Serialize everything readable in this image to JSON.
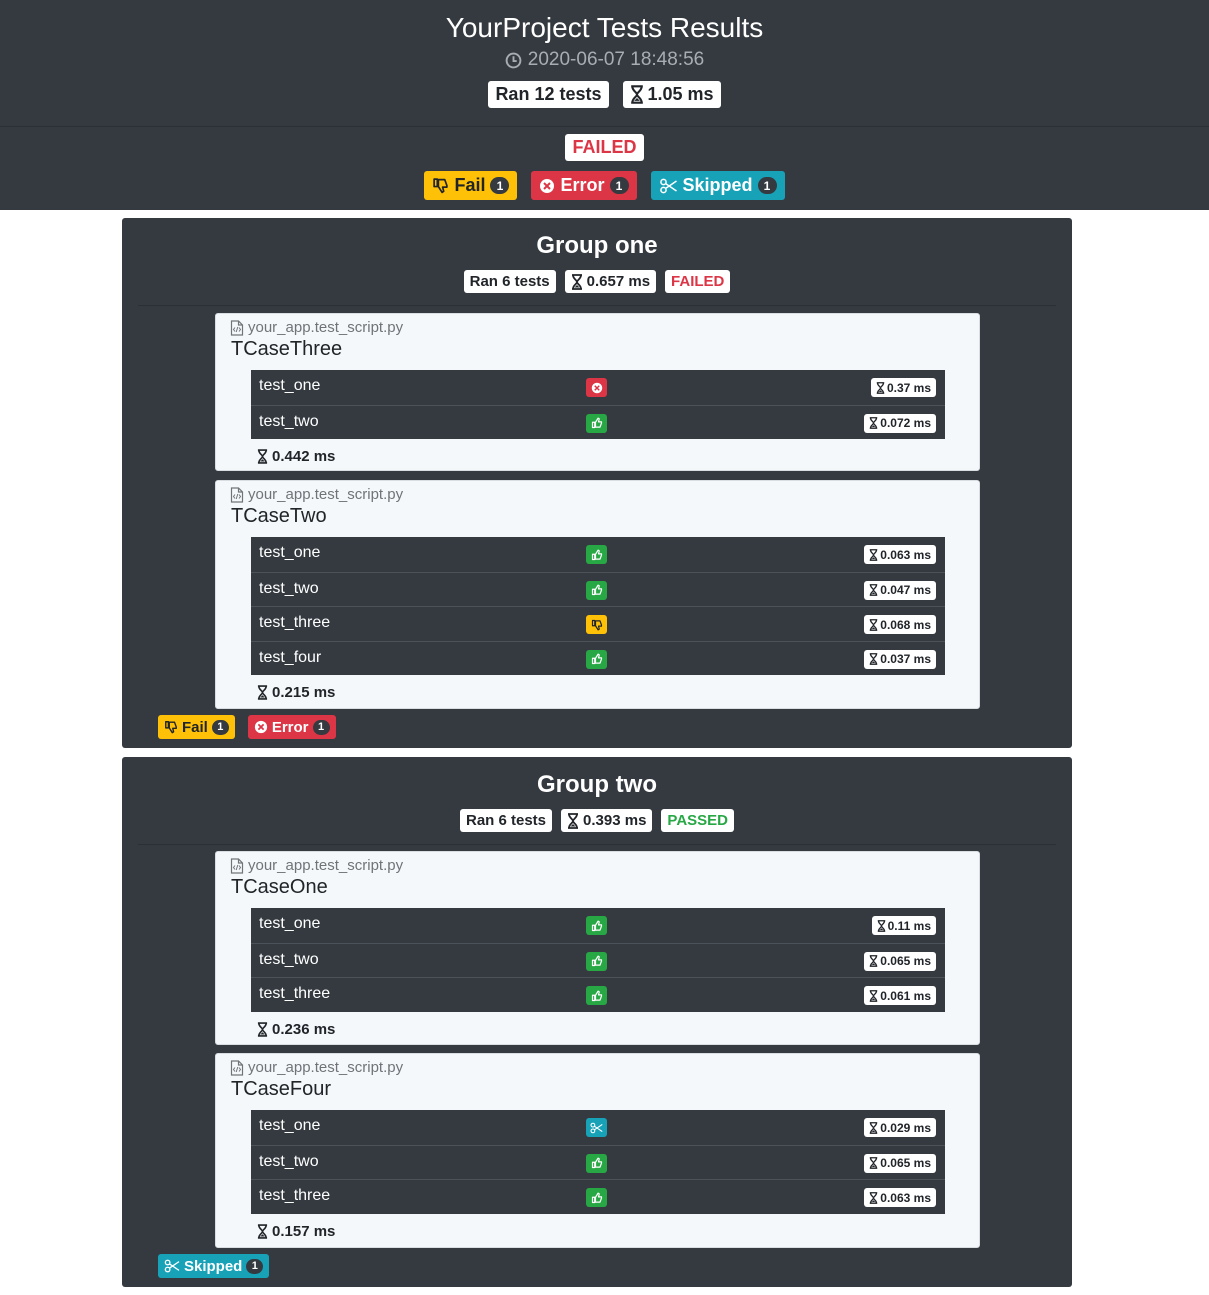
{
  "header": {
    "title": "YourProject Tests Results",
    "timestamp": "2020-06-07 18:48:56",
    "ran": "Ran 12 tests",
    "duration": "1.05 ms",
    "status": "FAILED",
    "counts": [
      {
        "label": "Fail",
        "count": "1",
        "icon": "thumbs-down-icon",
        "color": "#ffc107"
      },
      {
        "label": "Error",
        "count": "1",
        "icon": "times-circle-icon",
        "color": "#dc3545"
      },
      {
        "label": "Skipped",
        "count": "1",
        "icon": "scissors-icon",
        "color": "#17a2b8"
      }
    ]
  },
  "groups": [
    {
      "title": "Group one",
      "ran": "Ran 6 tests",
      "duration": "0.657 ms",
      "status": "FAILED",
      "cases": [
        {
          "file": "your_app.test_script.py",
          "name": "TCaseThree",
          "total": "0.442 ms",
          "tests": [
            {
              "name": "test_one",
              "result": "error",
              "time": "0.37 ms"
            },
            {
              "name": "test_two",
              "result": "pass",
              "time": "0.072 ms"
            }
          ]
        },
        {
          "file": "your_app.test_script.py",
          "name": "TCaseTwo",
          "total": "0.215 ms",
          "tests": [
            {
              "name": "test_one",
              "result": "pass",
              "time": "0.063 ms"
            },
            {
              "name": "test_two",
              "result": "pass",
              "time": "0.047 ms"
            },
            {
              "name": "test_three",
              "result": "fail",
              "time": "0.068 ms"
            },
            {
              "name": "test_four",
              "result": "pass",
              "time": "0.037 ms"
            }
          ]
        }
      ],
      "counts": [
        {
          "label": "Fail",
          "count": "1"
        },
        {
          "label": "Error",
          "count": "1"
        }
      ]
    },
    {
      "title": "Group two",
      "ran": "Ran 6 tests",
      "duration": "0.393 ms",
      "status": "PASSED",
      "cases": [
        {
          "file": "your_app.test_script.py",
          "name": "TCaseOne",
          "total": "0.236 ms",
          "tests": [
            {
              "name": "test_one",
              "result": "pass",
              "time": "0.11 ms"
            },
            {
              "name": "test_two",
              "result": "pass",
              "time": "0.065 ms"
            },
            {
              "name": "test_three",
              "result": "pass",
              "time": "0.061 ms"
            }
          ]
        },
        {
          "file": "your_app.test_script.py",
          "name": "TCaseFour",
          "total": "0.157 ms",
          "tests": [
            {
              "name": "test_one",
              "result": "skip",
              "time": "0.029 ms"
            },
            {
              "name": "test_two",
              "result": "pass",
              "time": "0.065 ms"
            },
            {
              "name": "test_three",
              "result": "pass",
              "time": "0.063 ms"
            }
          ]
        }
      ],
      "counts": [
        {
          "label": "Skipped",
          "count": "1"
        }
      ]
    }
  ]
}
